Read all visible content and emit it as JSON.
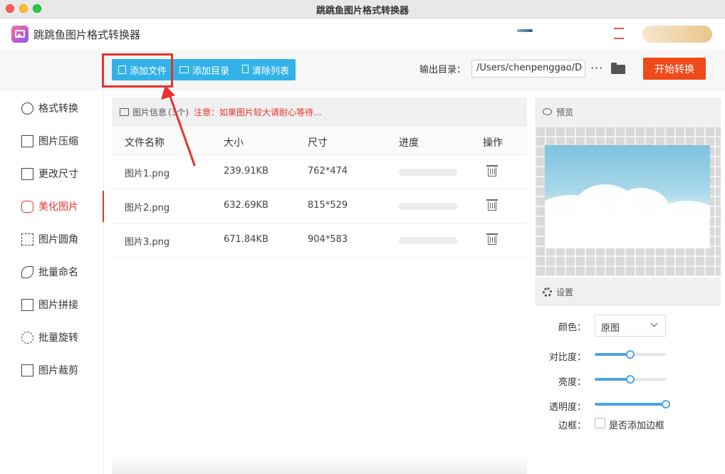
{
  "window": {
    "title": "跳跳鱼图片格式转换器"
  },
  "app": {
    "name": "跳跳鱼图片格式转换器"
  },
  "toolbar": {
    "add_file": "添加文件",
    "add_dir": "添加目录",
    "clear_list": "清除列表",
    "output_label": "输出目录：",
    "output_path": "/Users/chenpenggao/D",
    "more": "···",
    "start": "开始转换"
  },
  "sidebar": {
    "items": [
      {
        "label": "格式转换",
        "icon": "format-convert-icon",
        "active": false
      },
      {
        "label": "图片压缩",
        "icon": "compress-icon",
        "active": false
      },
      {
        "label": "更改尺寸",
        "icon": "resize-icon",
        "active": false
      },
      {
        "label": "美化图片",
        "icon": "beautify-icon",
        "active": true
      },
      {
        "label": "图片圆角",
        "icon": "round-corner-icon",
        "active": false
      },
      {
        "label": "批量命名",
        "icon": "rename-icon",
        "active": false
      },
      {
        "label": "图片拼接",
        "icon": "stitch-icon",
        "active": false
      },
      {
        "label": "批量旋转",
        "icon": "rotate-icon",
        "active": false
      },
      {
        "label": "图片裁剪",
        "icon": "crop-icon",
        "active": false
      }
    ]
  },
  "list": {
    "info_label": "图片信息",
    "count": "(3个)",
    "note": "注意：如果图片较大请耐心等待...",
    "columns": [
      "文件名称",
      "大小",
      "尺寸",
      "进度",
      "操作"
    ],
    "rows": [
      {
        "name": "图片1.png",
        "size": "239.91KB",
        "dims": "762*474",
        "progress": 0
      },
      {
        "name": "图片2.png",
        "size": "632.69KB",
        "dims": "815*529",
        "progress": 0
      },
      {
        "name": "图片3.png",
        "size": "671.84KB",
        "dims": "904*583",
        "progress": 0
      }
    ]
  },
  "preview": {
    "title": "预览"
  },
  "settings": {
    "title": "设置",
    "color_label": "颜色：",
    "color_value": "原图",
    "contrast_label": "对比度：",
    "contrast": 0.5,
    "brightness_label": "亮度：",
    "brightness": 0.5,
    "opacity_label": "透明度：",
    "opacity": 1.0,
    "border_label": "边框：",
    "border_checkbox_label": "是否添加边框",
    "border_checked": false
  },
  "colors": {
    "accent": "#33b2e8",
    "start_button": "#f04a1a",
    "active": "#e8322d",
    "slider": "#4da3e8"
  }
}
